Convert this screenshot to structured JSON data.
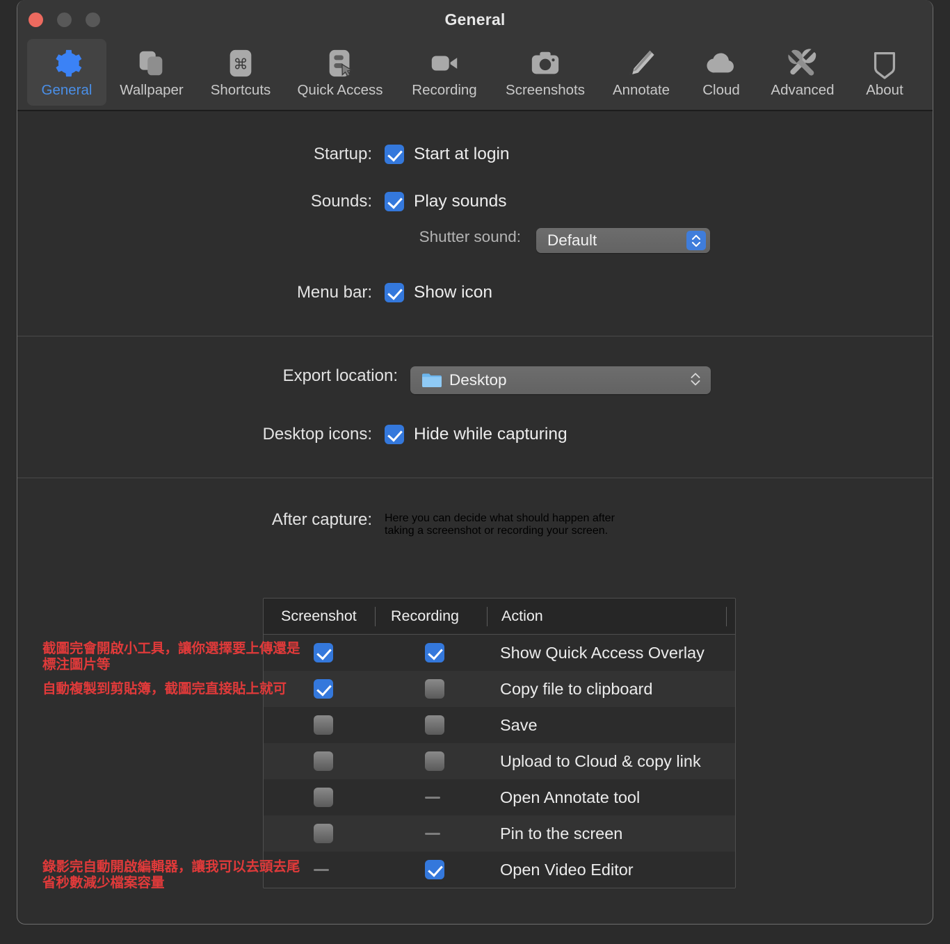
{
  "window": {
    "title": "General",
    "traffic_lights": [
      "close-button",
      "minimize-button",
      "maximize-button"
    ]
  },
  "toolbar": {
    "tabs": [
      {
        "id": "general",
        "label": "General",
        "icon": "gear-icon",
        "selected": true
      },
      {
        "id": "wallpaper",
        "label": "Wallpaper",
        "icon": "wallpaper-icon",
        "selected": false
      },
      {
        "id": "shortcuts",
        "label": "Shortcuts",
        "icon": "command-key-icon",
        "selected": false
      },
      {
        "id": "quick-access",
        "label": "Quick Access",
        "icon": "cursor-panel-icon",
        "selected": false
      },
      {
        "id": "recording",
        "label": "Recording",
        "icon": "video-camera-icon",
        "selected": false
      },
      {
        "id": "screenshots",
        "label": "Screenshots",
        "icon": "camera-icon",
        "selected": false
      },
      {
        "id": "annotate",
        "label": "Annotate",
        "icon": "marker-pen-icon",
        "selected": false
      },
      {
        "id": "cloud",
        "label": "Cloud",
        "icon": "cloud-icon",
        "selected": false
      },
      {
        "id": "advanced",
        "label": "Advanced",
        "icon": "tools-icon",
        "selected": false
      },
      {
        "id": "about",
        "label": "About",
        "icon": "app-badge-icon",
        "selected": false
      }
    ]
  },
  "general": {
    "startup": {
      "label": "Startup:",
      "checkbox_label": "Start at login",
      "checked": true
    },
    "sounds": {
      "label": "Sounds:",
      "checkbox_label": "Play sounds",
      "checked": true,
      "shutter_label": "Shutter sound:",
      "shutter_value": "Default"
    },
    "menu_bar": {
      "label": "Menu bar:",
      "checkbox_label": "Show icon",
      "checked": true
    }
  },
  "export": {
    "location_label": "Export location:",
    "location_value": "Desktop",
    "desktop_icons_label": "Desktop icons:",
    "desktop_icons_checkbox_label": "Hide while capturing",
    "desktop_icons_checked": true
  },
  "after_capture": {
    "label": "After capture:",
    "description": "Here you can decide what should happen after taking a screenshot or recording your screen.",
    "table": {
      "headers": [
        "Screenshot",
        "Recording",
        "Action"
      ],
      "rows": [
        {
          "screenshot": "checked",
          "recording": "checked",
          "action": "Show Quick Access Overlay"
        },
        {
          "screenshot": "checked",
          "recording": "unchecked",
          "action": "Copy file to clipboard"
        },
        {
          "screenshot": "unchecked",
          "recording": "unchecked",
          "action": "Save"
        },
        {
          "screenshot": "unchecked",
          "recording": "unchecked",
          "action": "Upload to Cloud & copy link"
        },
        {
          "screenshot": "unchecked",
          "recording": "disabled",
          "action": "Open Annotate tool"
        },
        {
          "screenshot": "unchecked",
          "recording": "disabled",
          "action": "Pin to the screen"
        },
        {
          "screenshot": "disabled",
          "recording": "checked",
          "action": "Open Video Editor"
        }
      ]
    }
  },
  "annotations": [
    {
      "id": "anno-quick-access",
      "text": "截圖完會開啟小工具，讓你選擇要上傳還是標注圖片等"
    },
    {
      "id": "anno-clipboard",
      "text": "自動複製到剪貼簿，截圖完直接貼上就可"
    },
    {
      "id": "anno-video-editor",
      "text": "錄影完自動開啟編輯器，讓我可以去頭去尾\n省秒數減少檔案容量"
    }
  ],
  "colors": {
    "accent_blue": "#3478dc",
    "tab_selected_text": "#4a8fe8",
    "annotation_red": "#e03a3a",
    "window_bg": "#2e2e2e",
    "toolbar_bg": "#373737"
  }
}
